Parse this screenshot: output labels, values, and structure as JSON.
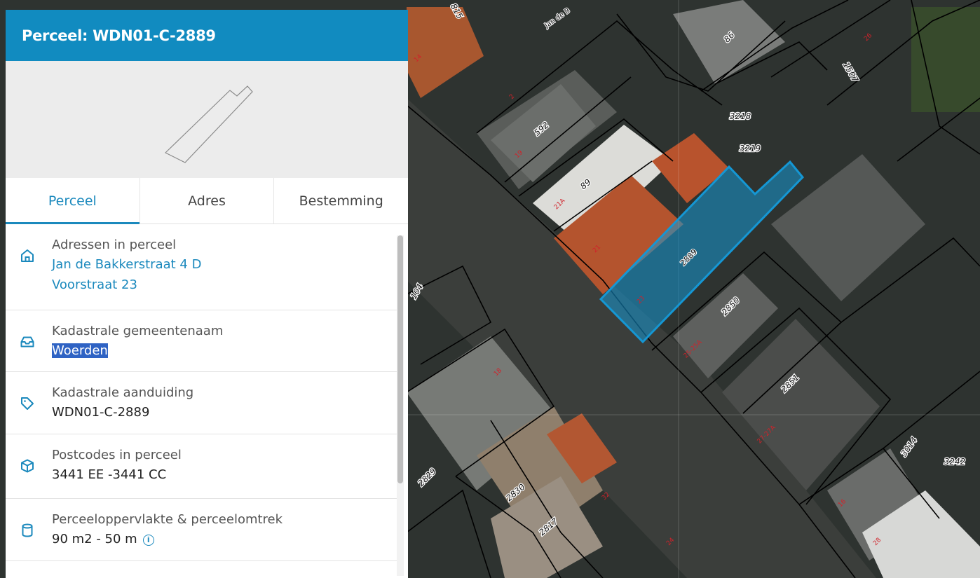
{
  "panel": {
    "title": "Perceel: WDN01-C-2889",
    "tabs": [
      {
        "label": "Perceel",
        "active": true
      },
      {
        "label": "Adres",
        "active": false
      },
      {
        "label": "Bestemming",
        "active": false
      }
    ],
    "rows": [
      {
        "icon": "home-icon",
        "label": "Adressen in perceel",
        "links": [
          "Jan de Bakkerstraat 4 D",
          "Voorstraat 23"
        ]
      },
      {
        "icon": "inbox-icon",
        "label": "Kadastrale gemeentenaam",
        "value": "Woerden",
        "selected": true
      },
      {
        "icon": "tag-icon",
        "label": "Kadastrale aanduiding",
        "value": "WDN01-C-2889"
      },
      {
        "icon": "package-icon",
        "label": "Postcodes in perceel",
        "value": "3441 EE -3441 CC"
      },
      {
        "icon": "cylinder-icon",
        "label": "Perceeloppervlakte & perceelomtrek",
        "value": "90 m2 - 50 m",
        "info_icon": "info-icon"
      }
    ]
  },
  "map": {
    "selected_parcel": "2889",
    "highlight_color": "#1597d4",
    "parcel_numbers": [
      "815",
      "86",
      "1507",
      "3218",
      "3219",
      "592",
      "89",
      "2850",
      "2851",
      "3014",
      "3242",
      "2829",
      "2830",
      "2817",
      "104"
    ],
    "house_numbers": [
      "19",
      "21A",
      "21",
      "23",
      "18",
      "25-25A",
      "27-27A",
      "16",
      "2",
      "26",
      "24",
      "28",
      "32",
      "14"
    ],
    "street_label": "Jan de B"
  }
}
